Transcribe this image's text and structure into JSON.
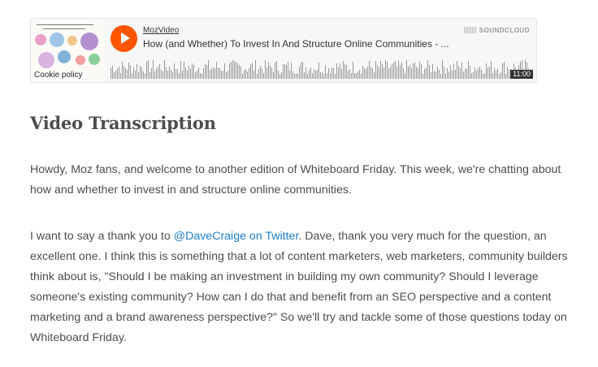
{
  "player": {
    "username": "MozVideo",
    "track_title": "How (and Whether) To Invest In And Structure Online Communities - ...",
    "brand": "SOUNDCLOUD",
    "duration": "11:00",
    "cookie_label": "Cookie policy",
    "accent_color": "#ff5500",
    "play_icon": "play-icon"
  },
  "article": {
    "heading": "Video Transcription",
    "paragraph1": "Howdy, Moz fans, and welcome to another edition of Whiteboard Friday. This week, we're chatting about how and whether to invest in and structure online communities.",
    "paragraph2_before": "I want to say a thank you to ",
    "paragraph2_link": "@DaveCraige on Twitter",
    "paragraph2_after": ". Dave, thank you very much for the question, an excellent one. I think this is something that a lot of content marketers, web marketers, community builders think about is, \"Should I be making an investment in building my own community? Should I leverage someone's existing community? How can I do that and benefit from an SEO perspective and a content marketing and a brand awareness perspective?\" So we'll try and tackle some of those questions today on Whiteboard Friday.",
    "link_color": "#1e7ec8"
  }
}
